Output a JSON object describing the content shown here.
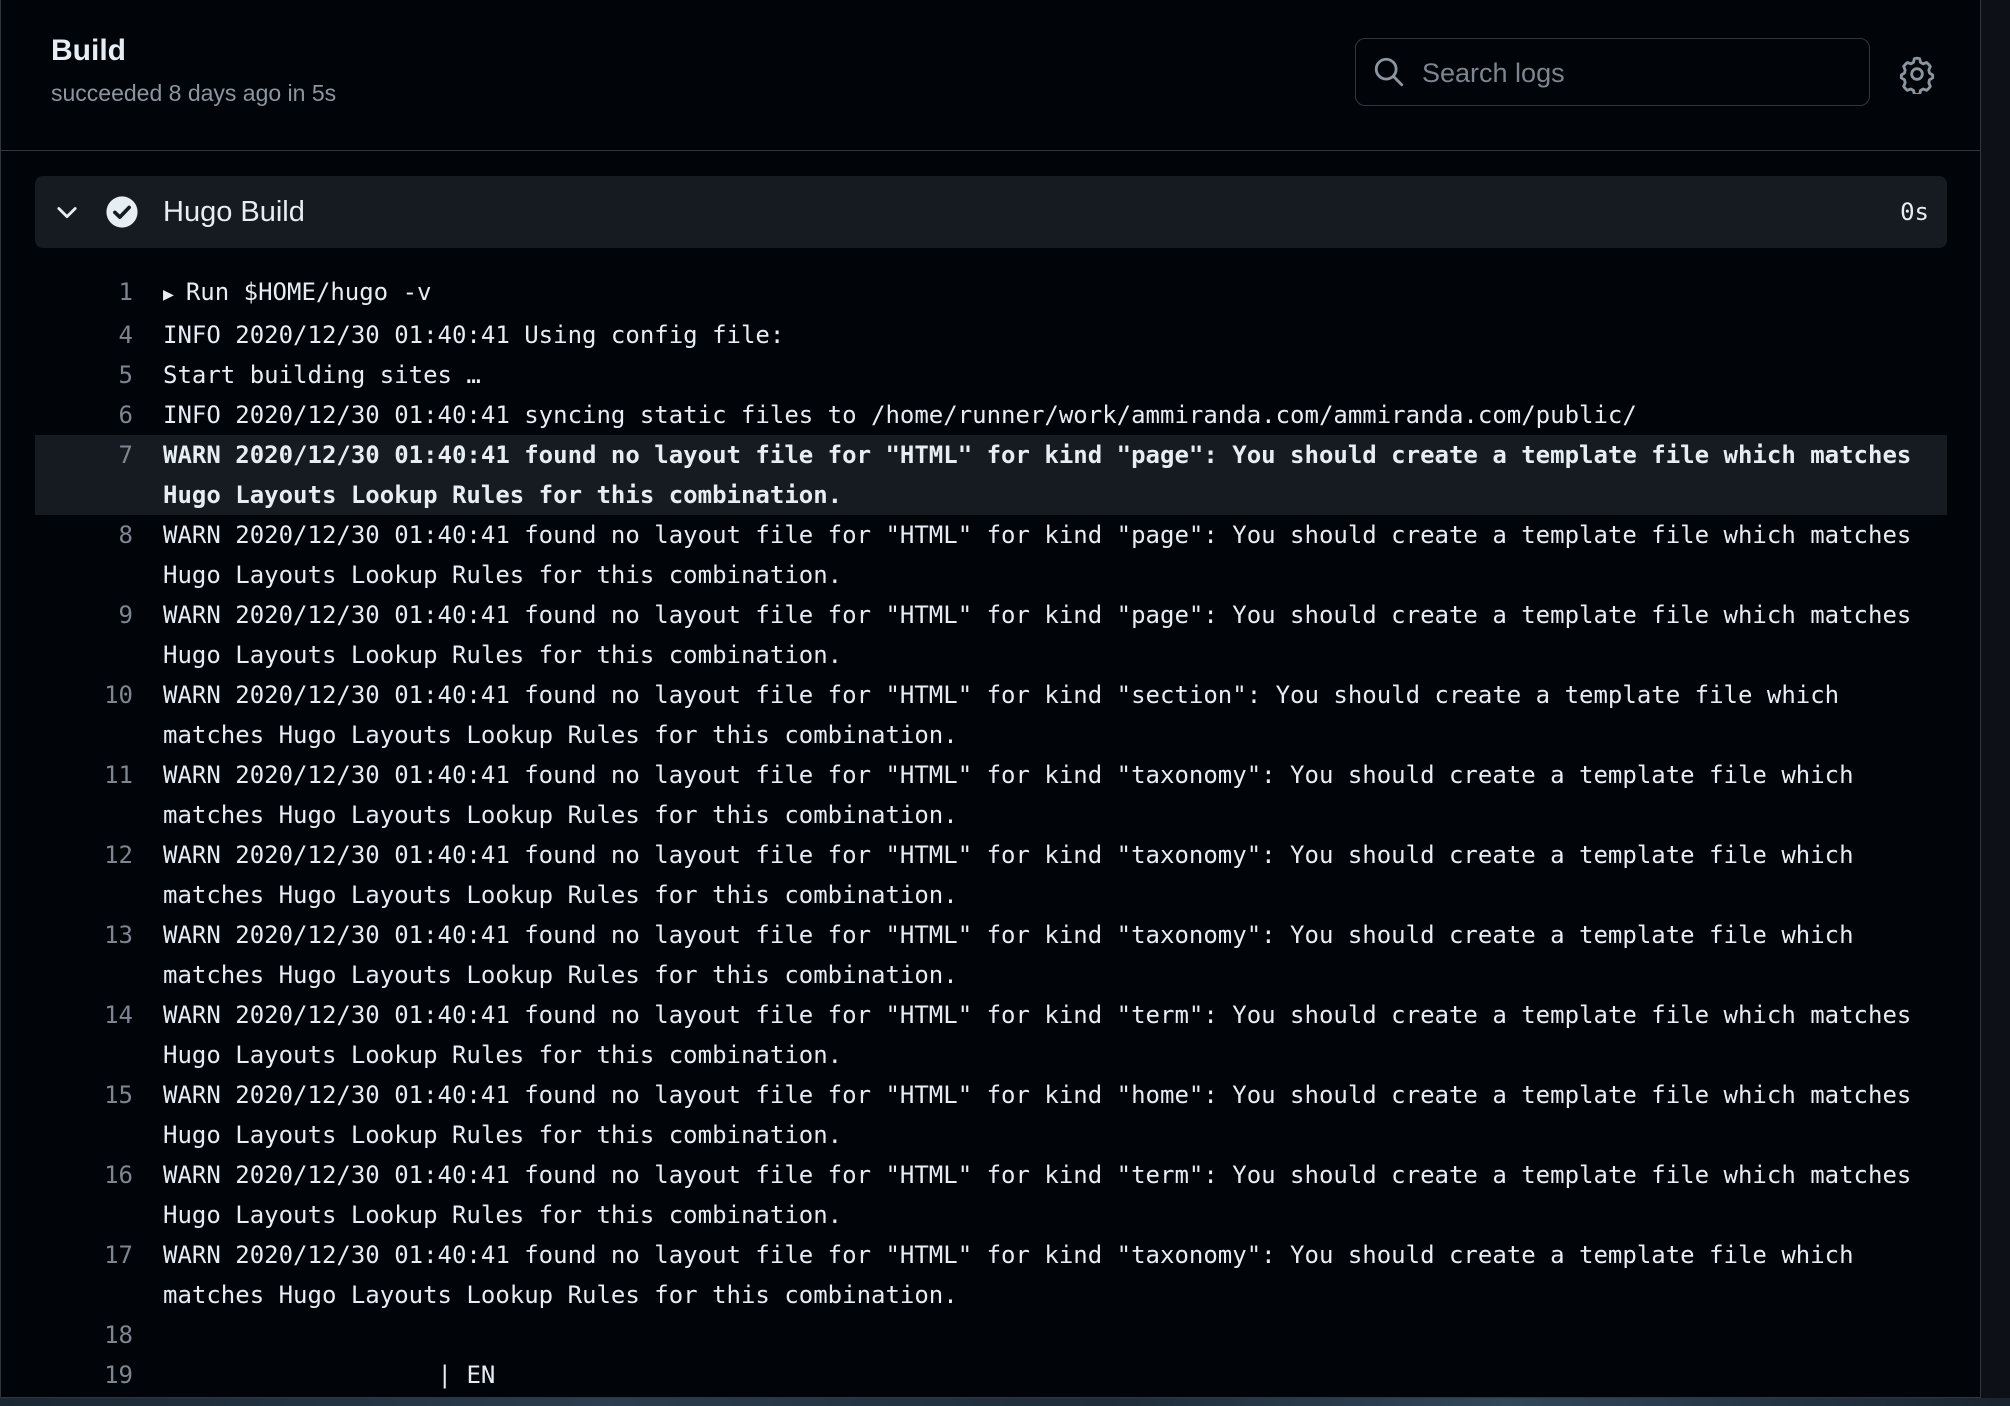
{
  "header": {
    "title": "Build",
    "subtitle": "succeeded 8 days ago in 5s",
    "search_placeholder": "Search logs"
  },
  "step": {
    "name": "Hugo Build",
    "duration": "0s",
    "status": "success"
  },
  "log_lines": [
    {
      "n": "1",
      "text": "Run $HOME/hugo -v",
      "group": true
    },
    {
      "n": "4",
      "text": "INFO 2020/12/30 01:40:41 Using config file:"
    },
    {
      "n": "5",
      "text": "Start building sites … "
    },
    {
      "n": "6",
      "text": "INFO 2020/12/30 01:40:41 syncing static files to /home/runner/work/ammiranda.com/ammiranda.com/public/"
    },
    {
      "n": "7",
      "text": "WARN 2020/12/30 01:40:41 found no layout file for \"HTML\" for kind \"page\": You should create a template file which matches Hugo Layouts Lookup Rules for this combination.",
      "highlight": true
    },
    {
      "n": "8",
      "text": "WARN 2020/12/30 01:40:41 found no layout file for \"HTML\" for kind \"page\": You should create a template file which matches Hugo Layouts Lookup Rules for this combination."
    },
    {
      "n": "9",
      "text": "WARN 2020/12/30 01:40:41 found no layout file for \"HTML\" for kind \"page\": You should create a template file which matches Hugo Layouts Lookup Rules for this combination."
    },
    {
      "n": "10",
      "text": "WARN 2020/12/30 01:40:41 found no layout file for \"HTML\" for kind \"section\": You should create a template file which matches Hugo Layouts Lookup Rules for this combination."
    },
    {
      "n": "11",
      "text": "WARN 2020/12/30 01:40:41 found no layout file for \"HTML\" for kind \"taxonomy\": You should create a template file which matches Hugo Layouts Lookup Rules for this combination."
    },
    {
      "n": "12",
      "text": "WARN 2020/12/30 01:40:41 found no layout file for \"HTML\" for kind \"taxonomy\": You should create a template file which matches Hugo Layouts Lookup Rules for this combination."
    },
    {
      "n": "13",
      "text": "WARN 2020/12/30 01:40:41 found no layout file for \"HTML\" for kind \"taxonomy\": You should create a template file which matches Hugo Layouts Lookup Rules for this combination."
    },
    {
      "n": "14",
      "text": "WARN 2020/12/30 01:40:41 found no layout file for \"HTML\" for kind \"term\": You should create a template file which matches Hugo Layouts Lookup Rules for this combination."
    },
    {
      "n": "15",
      "text": "WARN 2020/12/30 01:40:41 found no layout file for \"HTML\" for kind \"home\": You should create a template file which matches Hugo Layouts Lookup Rules for this combination."
    },
    {
      "n": "16",
      "text": "WARN 2020/12/30 01:40:41 found no layout file for \"HTML\" for kind \"term\": You should create a template file which matches Hugo Layouts Lookup Rules for this combination."
    },
    {
      "n": "17",
      "text": "WARN 2020/12/30 01:40:41 found no layout file for \"HTML\" for kind \"taxonomy\": You should create a template file which matches Hugo Layouts Lookup Rules for this combination."
    },
    {
      "n": "18",
      "text": ""
    },
    {
      "n": "19",
      "text": "                   | EN"
    }
  ],
  "colors": {
    "background": "#010409",
    "step_bg": "#161b22",
    "text": "#e6edf3",
    "muted": "#7d8590",
    "border": "#30363d"
  }
}
